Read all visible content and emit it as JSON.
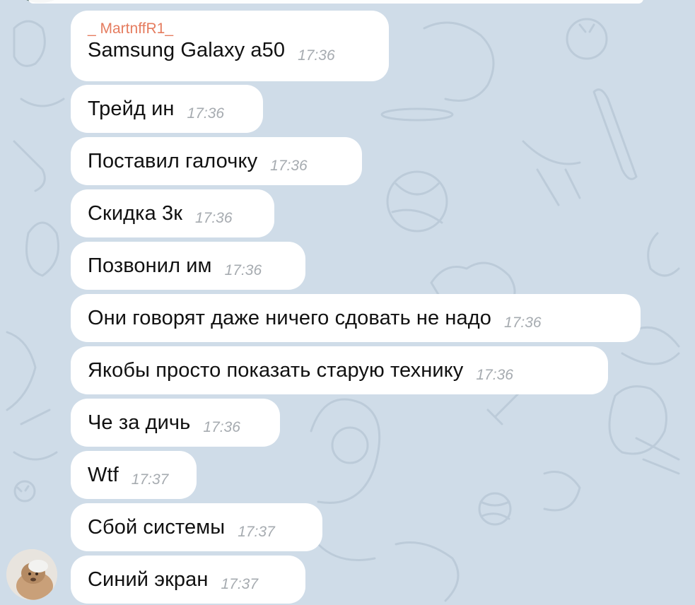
{
  "chat": {
    "sender": "_ MartnffR1_",
    "messages": [
      {
        "text": "Samsung Galaxy a50",
        "time": "17:36"
      },
      {
        "text": "Трейд ин",
        "time": "17:36"
      },
      {
        "text": "Поставил галочку",
        "time": "17:36"
      },
      {
        "text": "Скидка 3к",
        "time": "17:36"
      },
      {
        "text": "Позвонил им",
        "time": "17:36"
      },
      {
        "text": "Они говорят даже ничего сдовать не надо",
        "time": "17:36"
      },
      {
        "text": "Якобы просто показать старую технику",
        "time": "17:36"
      },
      {
        "text": "Че за дичь",
        "time": "17:36"
      },
      {
        "text": "Wtf",
        "time": "17:37"
      },
      {
        "text": "Сбой системы",
        "time": "17:37"
      },
      {
        "text": "Синий экран",
        "time": "17:37"
      }
    ]
  },
  "colors": {
    "wallpaper": "#cfdce8",
    "bubble": "#ffffff",
    "sender_name": "#e57c5f",
    "timestamp": "#a6abb0"
  }
}
